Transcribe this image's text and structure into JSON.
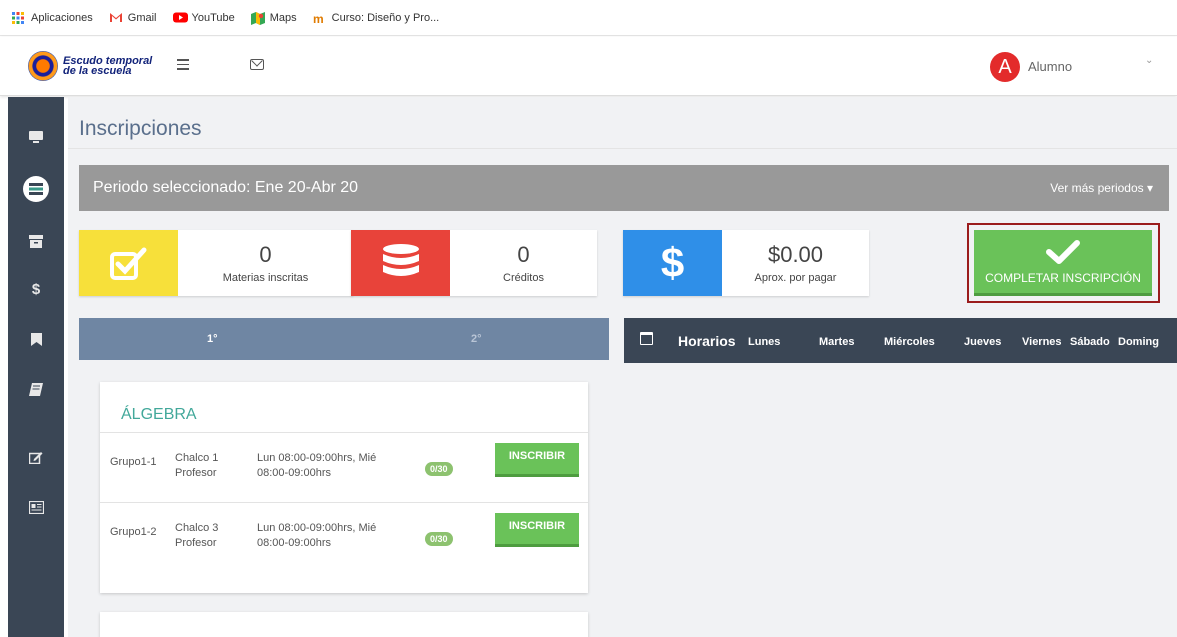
{
  "bookmarks": [
    {
      "label": "Aplicaciones",
      "icon": "apps-grid-icon"
    },
    {
      "label": "Gmail",
      "icon": "gmail-icon"
    },
    {
      "label": "YouTube",
      "icon": "youtube-icon"
    },
    {
      "label": "Maps",
      "icon": "maps-icon"
    },
    {
      "label": "Curso: Diseño y Pro...",
      "icon": "course-icon"
    }
  ],
  "header": {
    "logo_line1": "Escudo temporal",
    "logo_line2": "de la escuela",
    "avatar_letter": "A",
    "user_name": "Alumno"
  },
  "page": {
    "title": "Inscripciones"
  },
  "period": {
    "label": "Periodo seleccionado: Ene 20-Abr 20",
    "more": "Ver más periodos ▾"
  },
  "stats": [
    {
      "value": "0",
      "label": "Materias inscritas",
      "color": "#f7e03a",
      "icon": "checkbox-icon"
    },
    {
      "value": "0",
      "label": "Créditos",
      "color": "#e8433a",
      "icon": "database-icon"
    },
    {
      "value": "$0.00",
      "label": "Aprox. por pagar",
      "color": "#2f8fe8",
      "icon": "dollar-icon"
    }
  ],
  "complete_button": {
    "label": "COMPLETAR INSCRIPCIÓN",
    "color": "#6ac259"
  },
  "levels": {
    "tab1": "1°",
    "tab2": "2°"
  },
  "course": {
    "name": "ÁLGEBRA",
    "groups": [
      {
        "group": "Grupo1-1",
        "place": "Chalco 1",
        "teacher": "Profesor",
        "schedule": "Lun 08:00-09:00hrs, Mié 08:00-09:00hrs",
        "capacity": "0/30",
        "action": "INSCRIBIR"
      },
      {
        "group": "Grupo1-2",
        "place": "Chalco 3",
        "teacher": "Profesor",
        "schedule": "Lun 08:00-09:00hrs, Mié 08:00-09:00hrs",
        "capacity": "0/30",
        "action": "INSCRIBIR"
      }
    ]
  },
  "schedule": {
    "title": "Horarios",
    "days": [
      "Lunes",
      "Martes",
      "Miércoles",
      "Jueves",
      "Viernes",
      "Sábado",
      "Doming"
    ]
  },
  "colors": {
    "sidebar": "#3a4655",
    "period_bar": "#999999",
    "levels_header": "#6f86a3",
    "accent_green": "#6ac259",
    "highlight_border": "#9b1c1c"
  }
}
